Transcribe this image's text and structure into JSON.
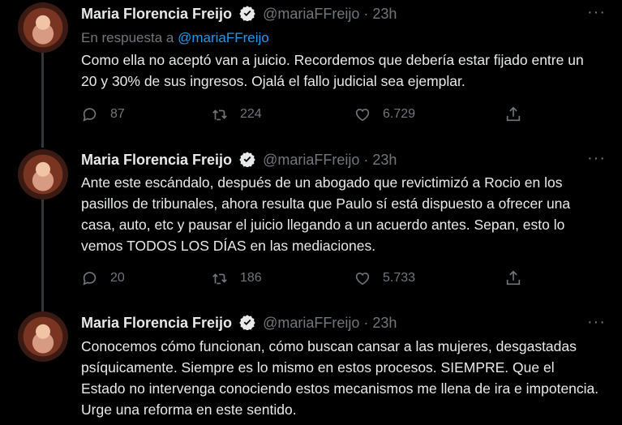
{
  "tweets": [
    {
      "name": "Maria Florencia Freijo",
      "handle": "@mariaFFreijo · 23h",
      "reply_prefix": "En respuesta a",
      "reply_handle": "@mariaFFreijo",
      "text": "Como ella no aceptó van a juicio. Recordemos que debería estar fijado entre un 20 y 30% de sus ingresos. Ojalá el fallo judicial sea ejemplar.",
      "replies": "87",
      "retweets": "224",
      "likes": "6.729"
    },
    {
      "name": "Maria Florencia Freijo",
      "handle": "@mariaFFreijo · 23h",
      "text": "Ante este escándalo, después de un abogado que revictimizó a Rocio en los pasillos de tribunales, ahora resulta que Paulo sí está dispuesto a ofrecer una casa, auto, etc y pausar el juicio llegando a un acuerdo antes. Sepan, esto lo vemos TODOS LOS DÍAS en las mediaciones.",
      "replies": "20",
      "retweets": "186",
      "likes": "5.733"
    },
    {
      "name": "Maria Florencia Freijo",
      "handle": "@mariaFFreijo · 23h",
      "text": "Conocemos cómo funcionan, cómo buscan cansar a las mujeres, desgastadas psíquicamente. Siempre es lo mismo en estos procesos. SIEMPRE. Que el Estado no intervenga conociendo estos mecanismos me llena de ira e impotencia. Urge una reforma en este sentido."
    }
  ],
  "more_label": "···"
}
